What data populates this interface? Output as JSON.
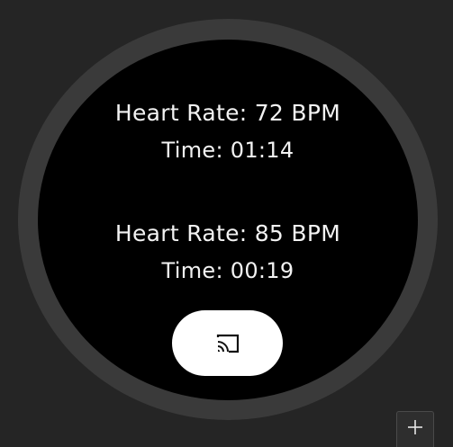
{
  "watch": {
    "readings": [
      {
        "heart_rate": "Heart Rate: 72 BPM",
        "time": "Time: 01:14"
      },
      {
        "heart_rate": "Heart Rate: 85 BPM",
        "time": "Time: 00:19"
      }
    ],
    "cast_button": {
      "icon": "cast-icon"
    }
  },
  "toolbar": {
    "add_button": {
      "icon": "plus-icon"
    }
  },
  "colors": {
    "background": "#252525",
    "bezel": "#3a3a3a",
    "screen": "#000000",
    "text": "#f2f2f2",
    "button": "#ffffff"
  }
}
